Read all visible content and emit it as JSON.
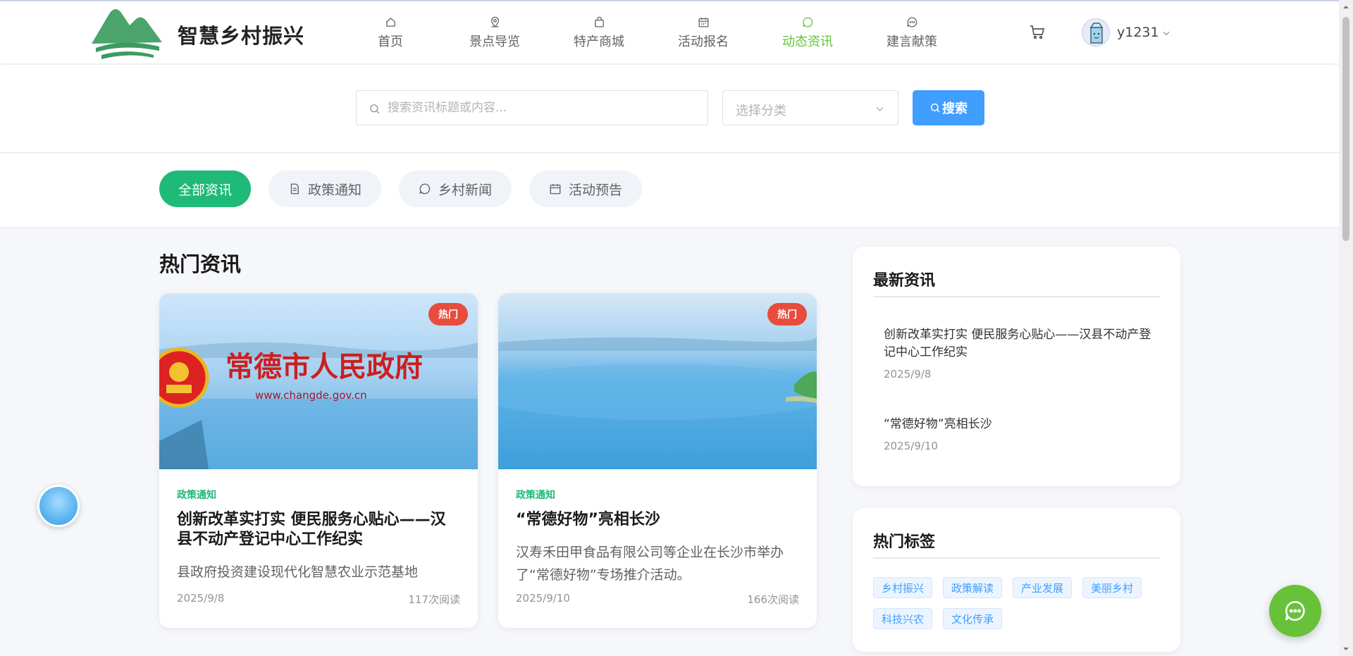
{
  "brand": {
    "name": "智慧乡村振兴",
    "colors": {
      "green": "#4aa46b",
      "active_nav": "#67c23a",
      "primary": "#409eff",
      "tab_active": "#1fb978",
      "hot_badge": "#e74c3c"
    }
  },
  "nav": [
    {
      "label": "首页",
      "icon": "home-icon"
    },
    {
      "label": "景点导览",
      "icon": "map-pin-icon"
    },
    {
      "label": "特产商城",
      "icon": "shopping-bag-icon"
    },
    {
      "label": "活动报名",
      "icon": "calendar-icon"
    },
    {
      "label": "动态资讯",
      "icon": "chat-bubble-icon",
      "active": true
    },
    {
      "label": "建言献策",
      "icon": "chat-dots-icon"
    }
  ],
  "user": {
    "name": "y1231",
    "cart_icon": "cart-icon",
    "avatar_icon": "milk-carton-avatar"
  },
  "search": {
    "placeholder": "搜索资讯标题或内容...",
    "category_placeholder": "选择分类",
    "button": "搜索"
  },
  "filters": [
    {
      "label": "全部资讯",
      "active": true
    },
    {
      "label": "政策通知",
      "icon": "document-icon"
    },
    {
      "label": "乡村新闻",
      "icon": "chat-bubble-icon"
    },
    {
      "label": "活动预告",
      "icon": "calendar-icon"
    }
  ],
  "hot": {
    "title": "热门资讯",
    "cards": [
      {
        "badge": "热门",
        "image_text": "常德市人民政府",
        "image_url_text": "www.changde.gov.cn",
        "category": "政策通知",
        "title": "创新改革实打实 便民服务心贴心——汉县不动产登记中心工作纪实",
        "desc": "县政府投资建设现代化智慧农业示范基地",
        "date": "2025/9/8",
        "reads": "117次阅读"
      },
      {
        "badge": "热门",
        "category": "政策通知",
        "title": "“常德好物”亮相长沙",
        "desc": "汉寿禾田甲食品有限公司等企业在长沙市举办了“常德好物”专场推介活动。",
        "date": "2025/9/10",
        "reads": "166次阅读"
      }
    ]
  },
  "latest": {
    "title": "最新资讯",
    "items": [
      {
        "title": "创新改革实打实 便民服务心贴心——汉县不动产登记中心工作纪实",
        "date": "2025/9/8"
      },
      {
        "title": "“常德好物”亮相长沙",
        "date": "2025/9/10"
      }
    ]
  },
  "tags": {
    "title": "热门标签",
    "items": [
      "乡村振兴",
      "政策解读",
      "产业发展",
      "美丽乡村",
      "科技兴农",
      "文化传承"
    ]
  }
}
